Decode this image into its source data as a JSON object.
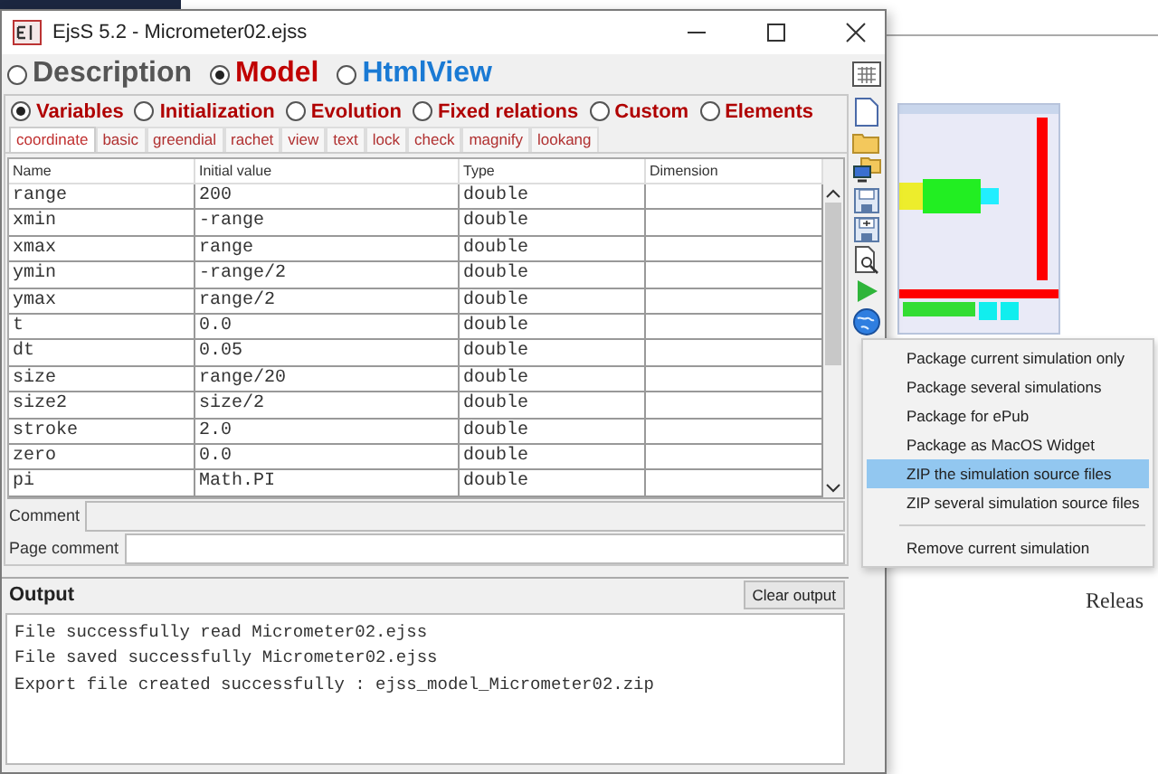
{
  "window": {
    "title": "EjsS 5.2 - Micrometer02.ejss"
  },
  "main_tabs": [
    {
      "label": "Description",
      "selected": false,
      "color": "#555555"
    },
    {
      "label": "Model",
      "selected": true,
      "color": "#c00000"
    },
    {
      "label": "HtmlView",
      "selected": false,
      "color": "#1a7ad4"
    }
  ],
  "model_tabs": [
    {
      "label": "Variables",
      "selected": true
    },
    {
      "label": "Initialization",
      "selected": false
    },
    {
      "label": "Evolution",
      "selected": false
    },
    {
      "label": "Fixed relations",
      "selected": false
    },
    {
      "label": "Custom",
      "selected": false
    },
    {
      "label": "Elements",
      "selected": false
    }
  ],
  "pages": [
    {
      "label": "coordinate",
      "selected": true
    },
    {
      "label": "basic",
      "selected": false
    },
    {
      "label": "greendial",
      "selected": false
    },
    {
      "label": "rachet",
      "selected": false
    },
    {
      "label": "view",
      "selected": false
    },
    {
      "label": "text",
      "selected": false
    },
    {
      "label": "lock",
      "selected": false
    },
    {
      "label": "check",
      "selected": false
    },
    {
      "label": "magnify",
      "selected": false
    },
    {
      "label": "lookang",
      "selected": false
    }
  ],
  "table": {
    "columns": [
      "Name",
      "Initial value",
      "Type",
      "Dimension"
    ],
    "rows": [
      [
        "range",
        "200",
        "double"
      ],
      [
        "xmin",
        "-range",
        "double"
      ],
      [
        "xmax",
        "range",
        "double"
      ],
      [
        "ymin",
        "-range/2",
        "double"
      ],
      [
        "ymax",
        "range/2",
        "double"
      ],
      [
        "t",
        "0.0",
        "double"
      ],
      [
        "dt",
        "0.05",
        "double"
      ],
      [
        "size",
        "range/20",
        "double"
      ],
      [
        "size2",
        "size/2",
        "double"
      ],
      [
        "stroke",
        "2.0",
        "double"
      ],
      [
        "zero",
        "0.0",
        "double"
      ],
      [
        "pi",
        "Math.PI",
        "double"
      ]
    ]
  },
  "comment": {
    "label": "Comment"
  },
  "page_comment": {
    "label": "Page comment"
  },
  "output": {
    "title": "Output",
    "button": "Clear output",
    "lines": [
      "File successfully read Micrometer02.ejss",
      "File saved successfully Micrometer02.ejss",
      "Export file created successfully : ejss_model_Micrometer02.zip"
    ]
  },
  "menu": {
    "groups": [
      [
        {
          "label": "Package current simulation only",
          "selected": false
        },
        {
          "label": "Package several simulations",
          "selected": false
        },
        {
          "label": "Package for ePub",
          "selected": false
        },
        {
          "label": "Package as MacOS Widget",
          "selected": false
        },
        {
          "label": "ZIP the simulation source files",
          "selected": true
        },
        {
          "label": "ZIP several simulation source files",
          "selected": false
        }
      ],
      [
        {
          "label": "Remove current simulation",
          "selected": false
        }
      ]
    ]
  },
  "background_text": "Releas"
}
